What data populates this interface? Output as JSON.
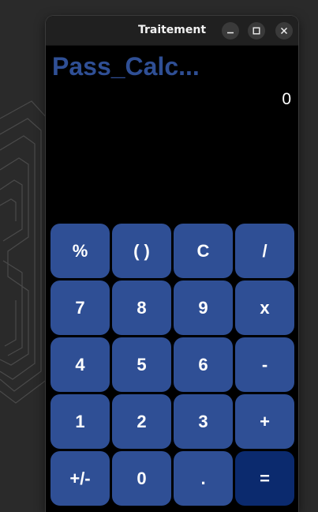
{
  "window": {
    "title": "Traitement"
  },
  "app": {
    "title": "Pass_Calc...",
    "display_value": "0"
  },
  "colors": {
    "key_bg": "#2f4f95",
    "equals_bg": "#0b2a6e",
    "title_color": "#2f4f95"
  },
  "keys": [
    {
      "label": "%",
      "name": "key-percent"
    },
    {
      "label": "( )",
      "name": "key-parentheses"
    },
    {
      "label": "C",
      "name": "key-clear"
    },
    {
      "label": "/",
      "name": "key-divide"
    },
    {
      "label": "7",
      "name": "key-7"
    },
    {
      "label": "8",
      "name": "key-8"
    },
    {
      "label": "9",
      "name": "key-9"
    },
    {
      "label": "x",
      "name": "key-multiply"
    },
    {
      "label": "4",
      "name": "key-4"
    },
    {
      "label": "5",
      "name": "key-5"
    },
    {
      "label": "6",
      "name": "key-6"
    },
    {
      "label": "-",
      "name": "key-subtract"
    },
    {
      "label": "1",
      "name": "key-1"
    },
    {
      "label": "2",
      "name": "key-2"
    },
    {
      "label": "3",
      "name": "key-3"
    },
    {
      "label": "+",
      "name": "key-add"
    },
    {
      "label": "+/-",
      "name": "key-sign"
    },
    {
      "label": "0",
      "name": "key-0"
    },
    {
      "label": ".",
      "name": "key-decimal"
    },
    {
      "label": "=",
      "name": "key-equals"
    }
  ]
}
